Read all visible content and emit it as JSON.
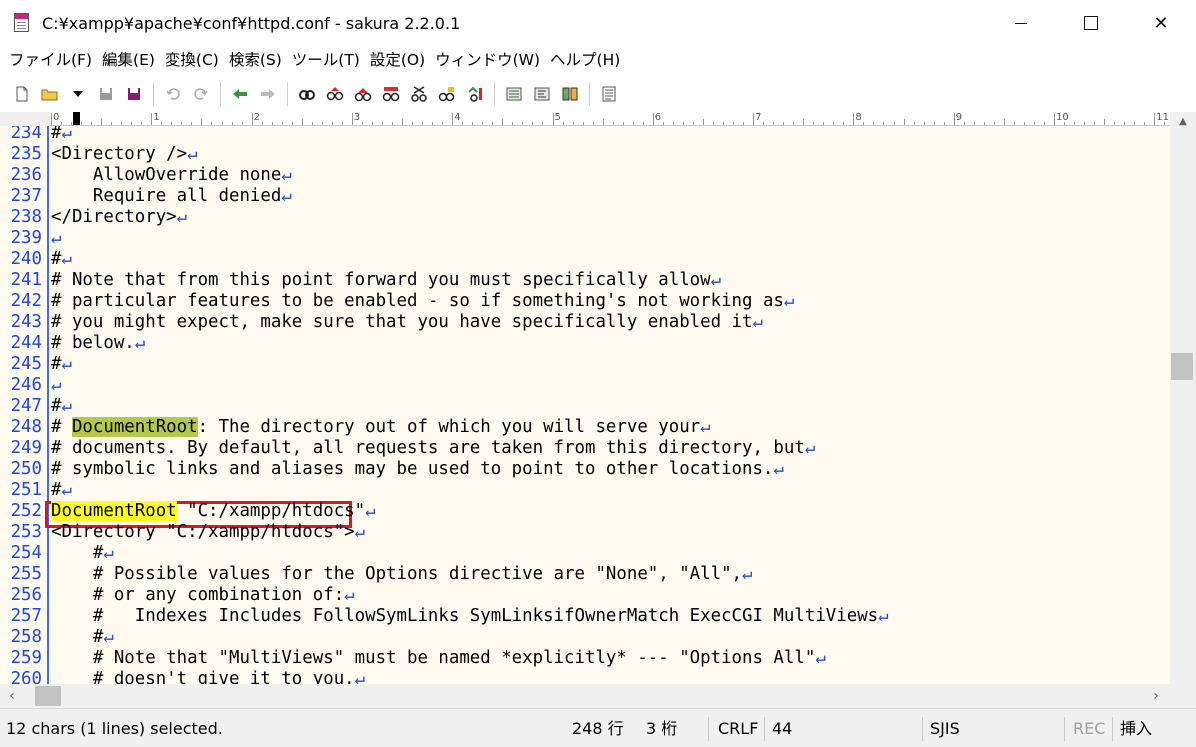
{
  "window": {
    "title": "C:¥xampp¥apache¥conf¥httpd.conf - sakura 2.2.0.1",
    "controls": {
      "minimize": "—",
      "maximize": "☐",
      "close": "✕"
    }
  },
  "menu": [
    "ファイル(F)",
    "編集(E)",
    "変換(C)",
    "検索(S)",
    "ツール(T)",
    "設定(O)",
    "ウィンドウ(W)",
    "ヘルプ(H)"
  ],
  "toolbar": {
    "icons": [
      "new-file-icon",
      "open-file-icon",
      "dropdown-icon",
      "save-icon",
      "save-all-icon",
      "undo-icon",
      "redo-icon",
      "jump-back-icon",
      "jump-forward-icon",
      "search-icon",
      "search-prev-icon",
      "search-next-icon",
      "grep-icon",
      "replace-icon",
      "bookmark-icon",
      "bookmark-next-icon",
      "compare-icon",
      "outline-icon",
      "macro-icon",
      "settings-icon"
    ]
  },
  "ruler": {
    "labels": [
      "0",
      "1",
      "2",
      "3",
      "4",
      "5",
      "6",
      "7",
      "8",
      "9",
      "10",
      "11"
    ]
  },
  "editor": {
    "eol_glyph": "↵",
    "lines": [
      {
        "n": "234",
        "text": "#"
      },
      {
        "n": "235",
        "text": "<Directory />"
      },
      {
        "n": "236",
        "text": "    AllowOverride none"
      },
      {
        "n": "237",
        "text": "    Require all denied"
      },
      {
        "n": "238",
        "text": "</Directory>"
      },
      {
        "n": "239",
        "text": ""
      },
      {
        "n": "240",
        "text": "#"
      },
      {
        "n": "241",
        "text": "# Note that from this point forward you must specifically allow"
      },
      {
        "n": "242",
        "text": "# particular features to be enabled - so if something's not working as"
      },
      {
        "n": "243",
        "text": "# you might expect, make sure that you have specifically enabled it"
      },
      {
        "n": "244",
        "text": "# below."
      },
      {
        "n": "245",
        "text": "#"
      },
      {
        "n": "246",
        "text": ""
      },
      {
        "n": "247",
        "text": "#"
      },
      {
        "n": "248",
        "pre": "# ",
        "hl": "DocumentRoot",
        "hlType": "green",
        "post": ": The directory out of which you will serve your"
      },
      {
        "n": "249",
        "text": "# documents. By default, all requests are taken from this directory, but"
      },
      {
        "n": "250",
        "text": "# symbolic links and aliases may be used to point to other locations."
      },
      {
        "n": "251",
        "text": "#"
      },
      {
        "n": "252",
        "pre": "",
        "hl": "DocumentRoot",
        "hlType": "yellow",
        "post": " \"C:/xampp/htdocs\""
      },
      {
        "n": "253",
        "text": "<Directory \"C:/xampp/htdocs\">"
      },
      {
        "n": "254",
        "text": "    #"
      },
      {
        "n": "255",
        "text": "    # Possible values for the Options directive are \"None\", \"All\","
      },
      {
        "n": "256",
        "text": "    # or any combination of:"
      },
      {
        "n": "257",
        "text": "    #   Indexes Includes FollowSymLinks SymLinksifOwnerMatch ExecCGI MultiViews"
      },
      {
        "n": "258",
        "text": "    #"
      },
      {
        "n": "259",
        "text": "    # Note that \"MultiViews\" must be named *explicitly* --- \"Options All\""
      },
      {
        "n": "260",
        "text": "    # doesn't give it to you."
      }
    ]
  },
  "status": {
    "selection": "12 chars (1 lines) selected.",
    "row": "248 行",
    "col": "3 桁",
    "eol": "CRLF",
    "code": "44",
    "encoding": "SJIS",
    "rec": "REC",
    "mode": "挿入"
  },
  "colors": {
    "line_number": "#1d46e6",
    "eol": "#1f4de0",
    "highlight_green": "#b4c94a",
    "highlight_yellow": "#ffff20",
    "annotation": "#e4141e",
    "editor_bg": "#fffbf0"
  }
}
